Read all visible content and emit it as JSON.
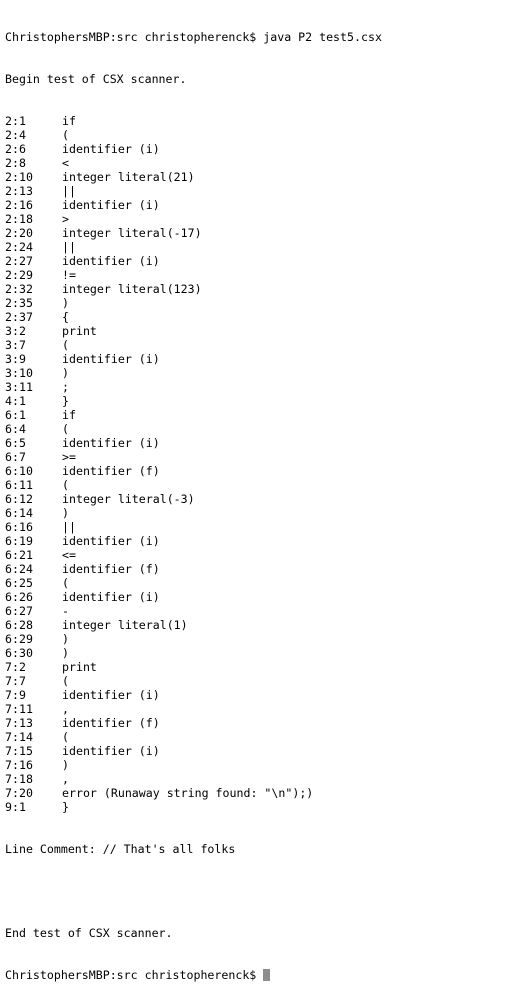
{
  "terminal": {
    "command_line": "ChristophersMBP:src christopherenck$ java P2 test5.csx",
    "begin_message": "Begin test of CSX scanner.",
    "tokens": [
      {
        "pos": "2:1",
        "text": "if"
      },
      {
        "pos": "2:4",
        "text": "("
      },
      {
        "pos": "2:6",
        "text": "identifier (i)"
      },
      {
        "pos": "2:8",
        "text": "<"
      },
      {
        "pos": "2:10",
        "text": "integer literal(21)"
      },
      {
        "pos": "2:13",
        "text": "||"
      },
      {
        "pos": "2:16",
        "text": "identifier (i)"
      },
      {
        "pos": "2:18",
        "text": ">"
      },
      {
        "pos": "2:20",
        "text": "integer literal(-17)"
      },
      {
        "pos": "2:24",
        "text": "||"
      },
      {
        "pos": "2:27",
        "text": "identifier (i)"
      },
      {
        "pos": "2:29",
        "text": "!="
      },
      {
        "pos": "2:32",
        "text": "integer literal(123)"
      },
      {
        "pos": "2:35",
        "text": ")"
      },
      {
        "pos": "2:37",
        "text": "{"
      },
      {
        "pos": "3:2",
        "text": "print"
      },
      {
        "pos": "3:7",
        "text": "("
      },
      {
        "pos": "3:9",
        "text": "identifier (i)"
      },
      {
        "pos": "3:10",
        "text": ")"
      },
      {
        "pos": "3:11",
        "text": ";"
      },
      {
        "pos": "4:1",
        "text": "}"
      },
      {
        "pos": "6:1",
        "text": "if"
      },
      {
        "pos": "6:4",
        "text": "("
      },
      {
        "pos": "6:5",
        "text": "identifier (i)"
      },
      {
        "pos": "6:7",
        "text": ">="
      },
      {
        "pos": "6:10",
        "text": "identifier (f)"
      },
      {
        "pos": "6:11",
        "text": "("
      },
      {
        "pos": "6:12",
        "text": "integer literal(-3)"
      },
      {
        "pos": "6:14",
        "text": ")"
      },
      {
        "pos": "6:16",
        "text": "||"
      },
      {
        "pos": "6:19",
        "text": "identifier (i)"
      },
      {
        "pos": "6:21",
        "text": "<="
      },
      {
        "pos": "6:24",
        "text": "identifier (f)"
      },
      {
        "pos": "6:25",
        "text": "("
      },
      {
        "pos": "6:26",
        "text": "identifier (i)"
      },
      {
        "pos": "6:27",
        "text": "-"
      },
      {
        "pos": "6:28",
        "text": "integer literal(1)"
      },
      {
        "pos": "6:29",
        "text": ")"
      },
      {
        "pos": "6:30",
        "text": ")"
      },
      {
        "pos": "7:2",
        "text": "print"
      },
      {
        "pos": "7:7",
        "text": "("
      },
      {
        "pos": "7:9",
        "text": "identifier (i)"
      },
      {
        "pos": "7:11",
        "text": ","
      },
      {
        "pos": "7:13",
        "text": "identifier (f)"
      },
      {
        "pos": "7:14",
        "text": "("
      },
      {
        "pos": "7:15",
        "text": "identifier (i)"
      },
      {
        "pos": "7:16",
        "text": ")"
      },
      {
        "pos": "7:18",
        "text": ","
      },
      {
        "pos": "7:20",
        "text": "error (Runaway string found: \"\\n\");)"
      },
      {
        "pos": "9:1",
        "text": "}"
      }
    ],
    "line_comment": "Line Comment: // That's all folks",
    "end_message": "End test of CSX scanner.",
    "prompt": "ChristophersMBP:src christopherenck$",
    "colors": {
      "background": "#ffffff",
      "text": "#000000",
      "cursor": "#8e8e8e"
    }
  }
}
